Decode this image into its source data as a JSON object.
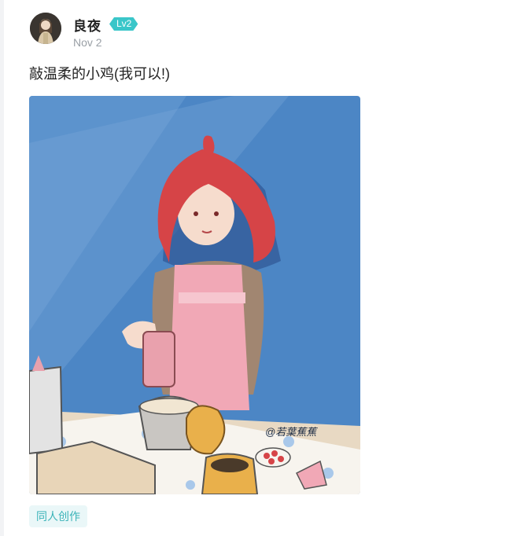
{
  "post": {
    "author": {
      "name": "良夜",
      "level_badge": "Lv2"
    },
    "date": "Nov 2",
    "title": "敲温柔的小鸡(我可以!)",
    "image": {
      "signature": "@若葉蕉蕉"
    },
    "tags": [
      "同人创作"
    ]
  },
  "colors": {
    "badge": "#3ac6c9",
    "tag_bg": "#eaf7f8",
    "tag_text": "#3ab3b8",
    "artwork_bg": "#4c86c5"
  }
}
